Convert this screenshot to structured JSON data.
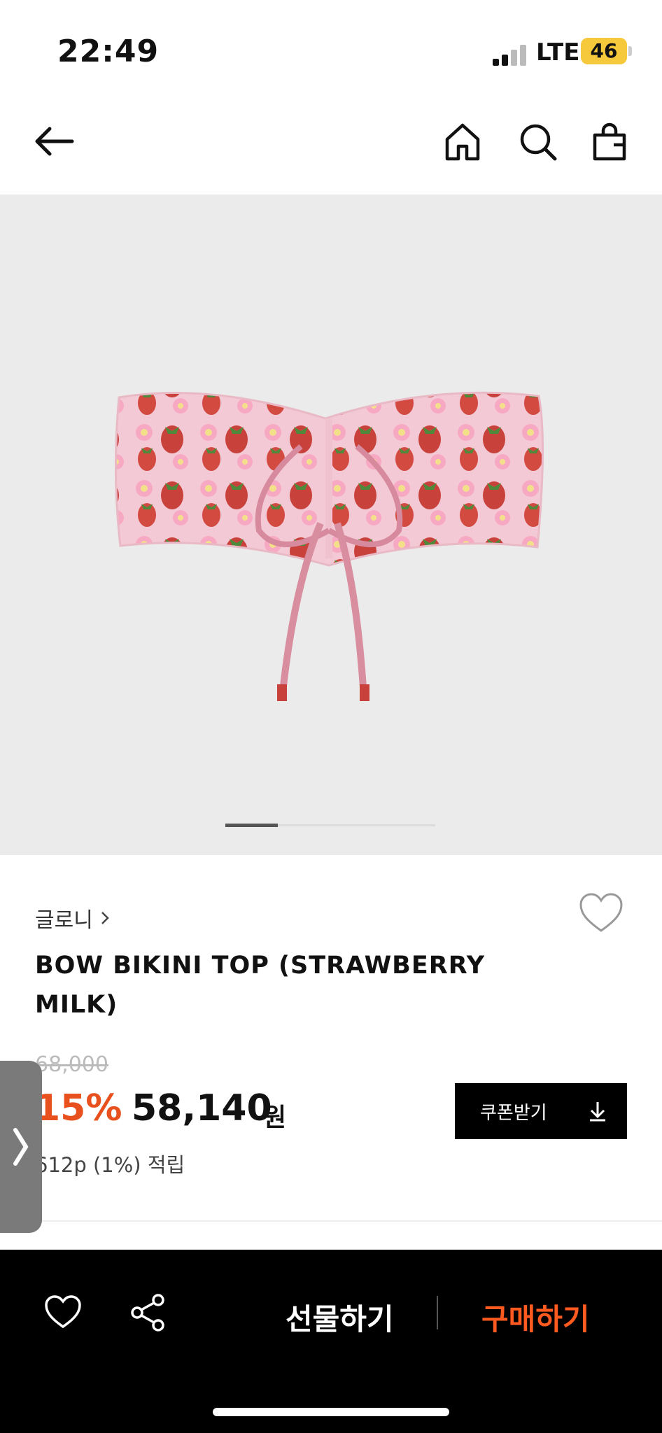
{
  "status_bar": {
    "time": "22:49",
    "network": "LTE",
    "battery": "46"
  },
  "nav": {
    "icons": [
      "back-arrow-icon",
      "home-icon",
      "search-icon",
      "shopping-bag-icon"
    ]
  },
  "gallery": {
    "image": "strawberry print strapless bikini top with tie",
    "pager_position": 0.25
  },
  "product": {
    "brand": "글로니",
    "title": "BOW BIKINI TOP (STRAWBERRY MILK)",
    "original_price": "68,000",
    "discount": "15%",
    "price": "58,140",
    "currency": "원",
    "points": "612p (1%) 적립",
    "coupon_label": "쿠폰받기"
  },
  "bottom_bar": {
    "gift_label": "선물하기",
    "buy_label": "구매하기"
  },
  "colors": {
    "accent": "#e8501e",
    "buy": "#ff5a1f",
    "coupon_bg": "#000000",
    "battery": "#f5c93b"
  }
}
